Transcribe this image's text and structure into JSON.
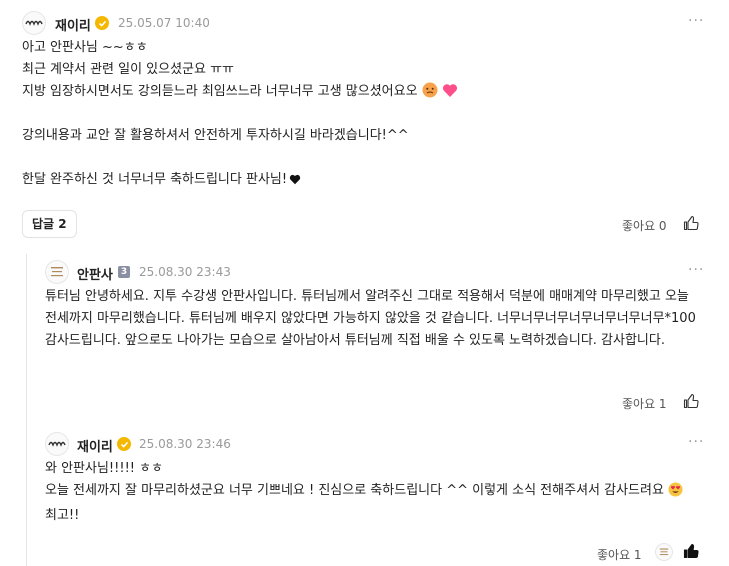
{
  "comment": {
    "author": "재이리",
    "date": "25.05.07 10:40",
    "lines": [
      "아고 안판사님 ~~ㅎㅎ",
      "최근 계약서 관련 일이 있으셨군요 ㅠㅠ",
      "지방 임장하시면서도 강의듣느라 최임쓰느라 너무너무 고생 많으셨어요오",
      "",
      "강의내용과 교안 잘 활용하셔서 안전하게 투자하시길 바라겠습니다!^^",
      "",
      "한달 완주하신 것 너무너무 축하드립니다 판사님!"
    ],
    "reply_button": "답글 2",
    "like_label": "좋아요 0"
  },
  "reply1": {
    "author": "안판사",
    "grade": "3",
    "date": "25.08.30 23:43",
    "text": "튜터님 안녕하세요. 지투 수강생 안판사입니다. 튜터님께서 알려주신 그대로 적용해서 덕분에 매매계약 마무리했고 오늘 전세까지 마무리했습니다. 튜터님께 배우지 않았다면 가능하지 않았을 것 같습니다. 너무너무너무너무너무너무너무*100 감사드립니다. 앞으로도 나아가는 모습으로 살아남아서 튜터님께 직접 배울 수 있도록 노력하겠습니다. 감사합니다.",
    "like_label": "좋아요 1"
  },
  "reply2": {
    "author": "재이리",
    "date": "25.08.30 23:46",
    "line1": "와 안판사님!!!!! ㅎㅎ",
    "text": "오늘 전세까지 잘 마무리하셨군요 너무 기쁘네요 ! 진심으로 축하드립니다 ^^ 이렇게 소식 전해주셔서 감사드려요",
    "text_tail": "최고!!",
    "like_label": "좋아요 1"
  },
  "icons": {
    "verified": "check-badge-icon",
    "grade": "grade-badge-icon",
    "more": "more-options-icon",
    "like": "thumbs-up-icon"
  },
  "colors": {
    "badge": "#f5b800",
    "text": "#1f1f1f",
    "muted": "#9a9a9a",
    "heart_black": "#111111",
    "heart_pink": "#ff4f8b"
  }
}
